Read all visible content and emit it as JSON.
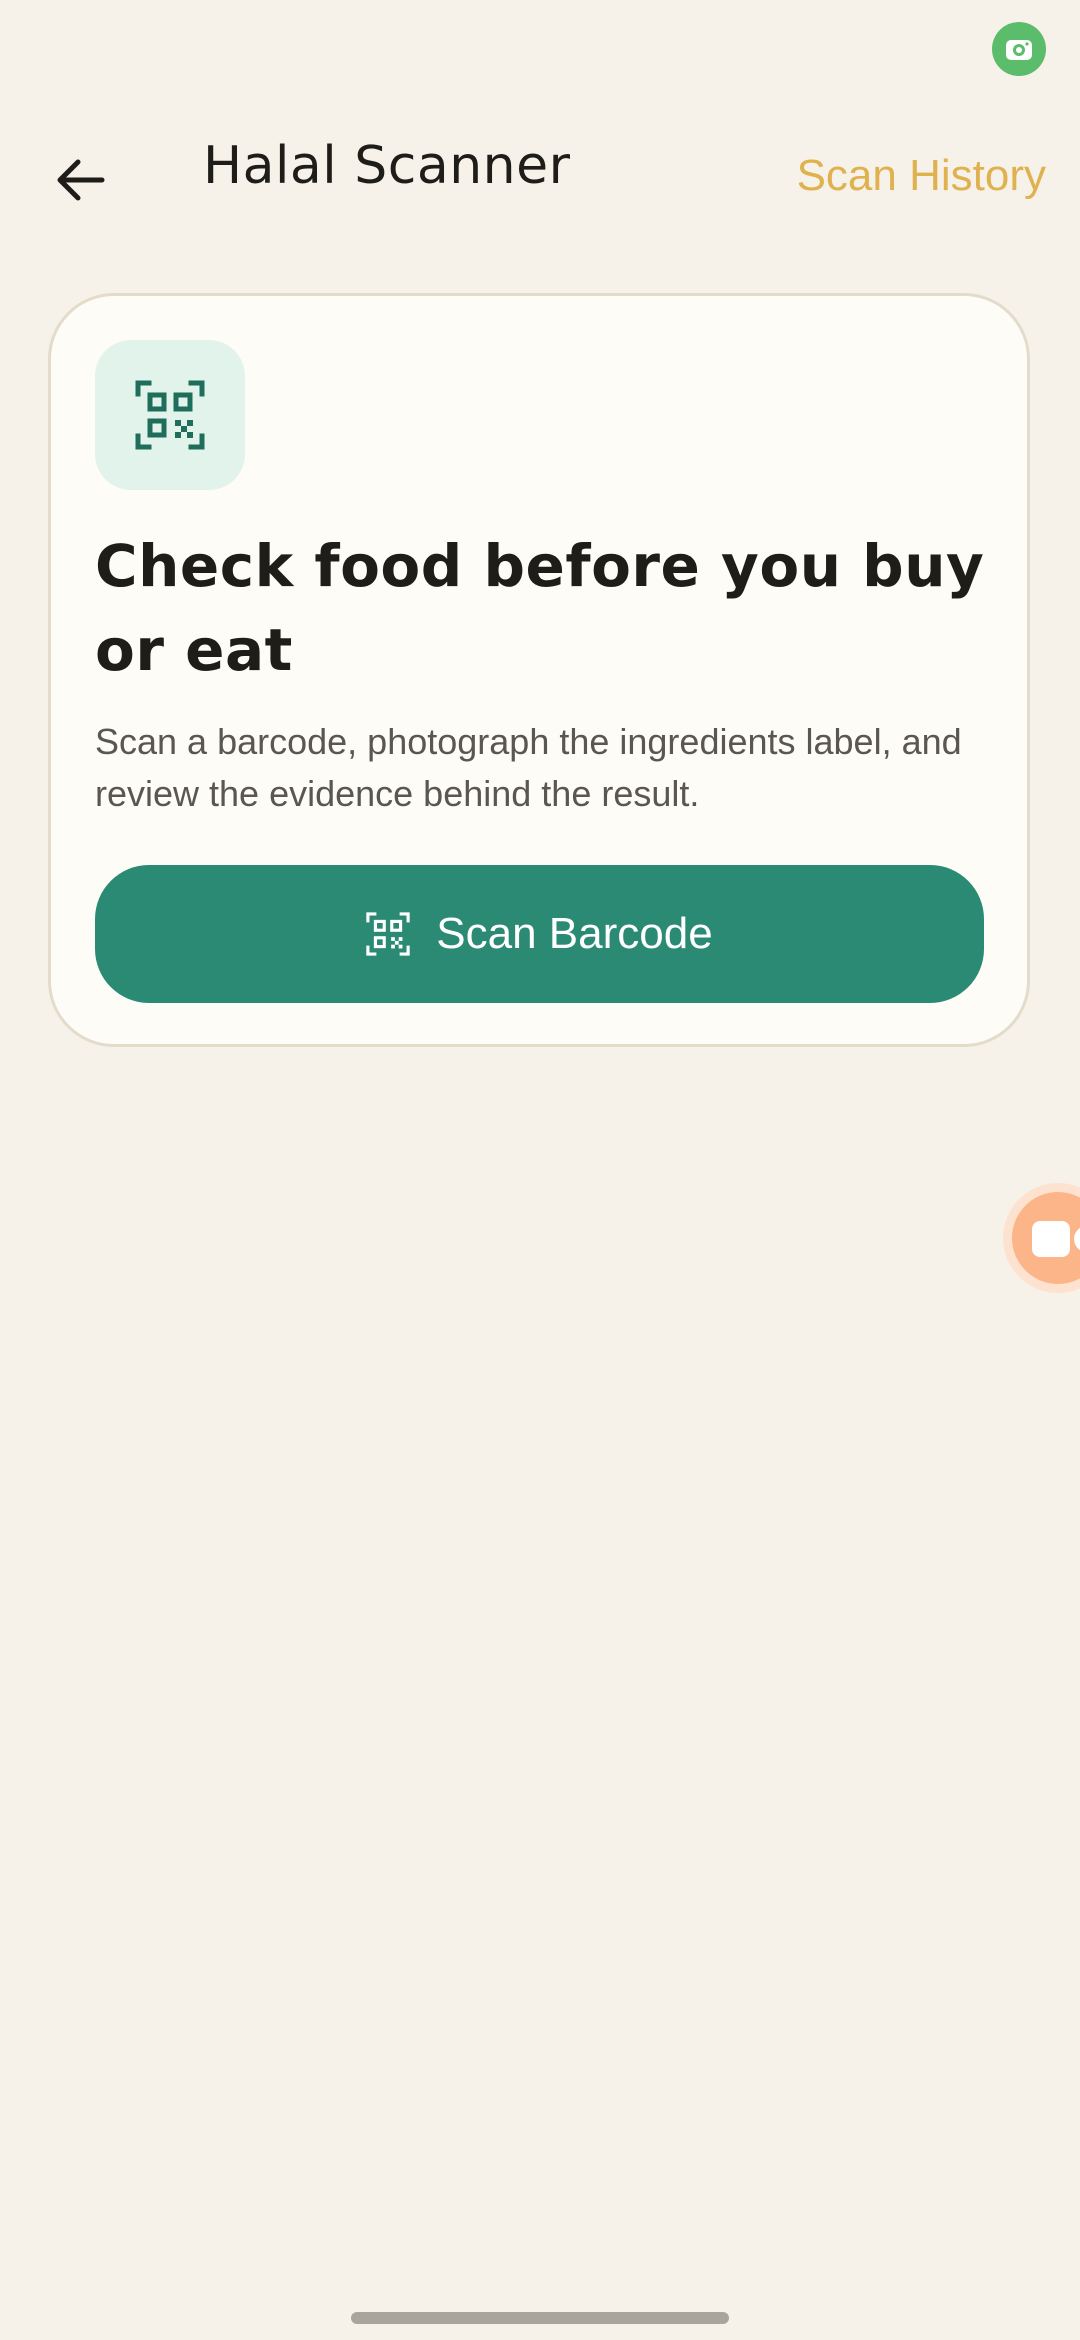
{
  "status_bar": {
    "indicator_icon": "camera-icon",
    "indicator_color": "#5bbd6b"
  },
  "header": {
    "back_icon": "arrow-left-icon",
    "title": "Halal Scanner",
    "history_label": "Scan History",
    "accent_color": "#dfb24f"
  },
  "card": {
    "icon": "qr-code-icon",
    "heading": "Check food before you buy or eat",
    "description": "Scan a barcode, photograph the ingredients label, and review the evidence behind the result.",
    "scan_button": {
      "icon": "qr-code-icon",
      "label": "Scan Barcode",
      "color": "#2b8a74"
    }
  },
  "floating_button": {
    "icon": "chat-bubble-icon",
    "color": "#fbb589"
  },
  "colors": {
    "background": "#f6f2e9",
    "card": "#fefcf7"
  }
}
